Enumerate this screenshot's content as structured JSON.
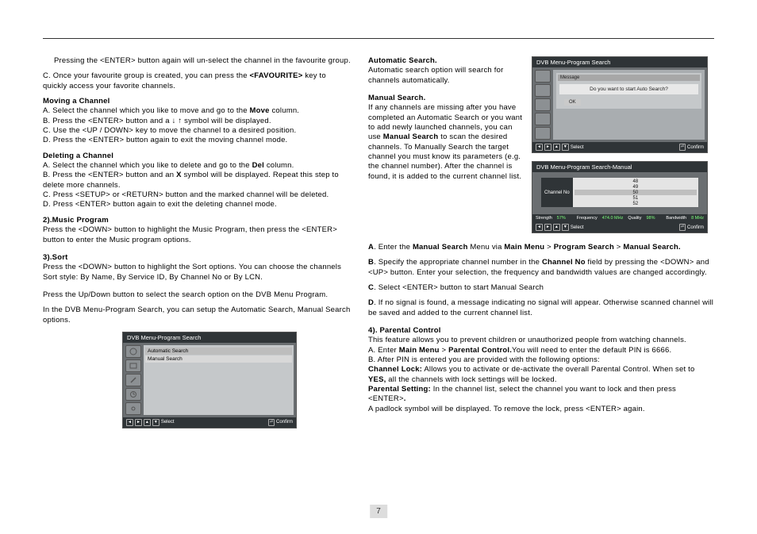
{
  "pageNumber": "7",
  "left": {
    "intro1": "Pressing the <ENTER>  button again will un-select the channel in the favourite group.",
    "intro2": "C.  Once your favourite group is created, you can press the ",
    "intro2b": "<FAVOURITE>",
    "intro2c": " key to quickly access your favorite channels.",
    "moving_title": "Moving a Channel",
    "moving_a_pre": "A. Select the channel which you like to move and go to the ",
    "moving_a_bold": "Move",
    "moving_a_post": " column.",
    "moving_b": "B. Press the <ENTER> button and a  ↓  ↑  symbol will be displayed.",
    "moving_c": "C. Use the <UP / DOWN> key to move the channel to a desired position.",
    "moving_d": "D. Press the <ENTER> button again to exit the moving channel mode.",
    "deleting_title": "Deleting a Channel",
    "deleting_a_pre": "A. Select the channel which you like to delete and go to the ",
    "deleting_a_bold": "Del",
    "deleting_a_post": " column.",
    "deleting_b_pre": "B. Press the <ENTER> button  and an ",
    "deleting_b_bold": "X",
    "deleting_b_post": " symbol will be displayed. Repeat this step to delete more channels.",
    "deleting_c": "C. Press <SETUP> or <RETURN> button and the marked channel will be deleted.",
    "deleting_d": "D. Press <ENTER> button again to exit the deleting channel mode.",
    "music_title": "2).Music Program",
    "music_body": "Press the <DOWN> button to highlight the Music Program, then press the <ENTER> button to enter the Music program options.",
    "sort_title": "3).Sort",
    "sort_body": "Press the <DOWN> button to highlight the Sort options. You can choose the channels Sort style: By Name, By Service ID, By Channel No or By LCN.",
    "search_intro1": "Press the Up/Down button to select the search option on the DVB Menu Program.",
    "search_intro2": "In the DVB Menu-Program Search, you can setup the Automatic Search, Manual Search options."
  },
  "right": {
    "auto_title": "Automatic Search.",
    "auto_body": "Automatic search option will search for channels automatically.",
    "manual_title": "Manual Search.",
    "manual_body_pre": "If any channels are missing after you have completed an Automatic Search or you want to add newly launched channels, you can use ",
    "manual_body_bold": "Manual Search",
    "manual_body_post": " to scan the desired channels. To Manually Search the target channel you must know its parameters (e.g. the channel number).  After the channel is found, it is added to the current channel list.",
    "step_a_pre": "A",
    "step_a_1": ". Enter the ",
    "step_a_bold1": "Manual Search",
    "step_a_2": " Menu via ",
    "step_a_bold2": "Main Menu",
    "step_a_3": " > ",
    "step_a_bold3": "Program Search",
    "step_a_4": " > ",
    "step_a_bold4": "Manual Search.",
    "step_b_pre": "B",
    "step_b_1": ". Specify the appropriate channel number in the ",
    "step_b_bold": "Channel No",
    "step_b_2": " field by pressing the <DOWN> and <UP> button. Enter your selection, the frequency and bandwidth values are changed accordingly.",
    "step_c_pre": "C",
    "step_c_body": ". Select <ENTER> button to start Manual Search",
    "step_d_pre": "D",
    "step_d_body": ". If no signal is found, a message indicating no signal will appear. Otherwise scanned channel will be saved and added to the current channel list.",
    "parental_title": "4). Parental Control",
    "parental_1": "This feature allows you to prevent children or unauthorized people from watching channels.",
    "parental_2_pre": "A. Enter ",
    "parental_2_b1": "Main Menu",
    "parental_2_mid": " > ",
    "parental_2_b2": "Parental Control.",
    "parental_2_post": "You will need to enter the default PIN is 6666.",
    "parental_3": "B. After PIN is entered you are provided with the following options:",
    "parental_4_b": "Channel Lock:",
    "parental_4": " Allows you to activate or de-activate the overall Parental Control. When set to ",
    "parental_4_b2": "YES,",
    "parental_4_post": " all the channels with lock settings will be locked.",
    "parental_5_b": "Parental Setting:",
    "parental_5": " In the channel list, select the channel you want to lock and then press <ENTER>",
    "parental_5_b2": ".",
    "parental_6": "A padlock symbol will be displayed. To remove the lock, press  <ENTER> again."
  },
  "fig1": {
    "title": "DVB Menu-Program Search",
    "opt1": "Automatic Search",
    "opt2": "Manual Search",
    "footer_select": "Select",
    "footer_confirm": "Confirm"
  },
  "fig2": {
    "title": "DVB Menu-Program Search",
    "msg_title": "Message",
    "msg_body": "Do you want to start Auto Search?",
    "ok": "OK",
    "footer_select": "Select",
    "footer_confirm": "Confirm"
  },
  "fig3": {
    "title": "DVB Menu-Program Search-Manual",
    "channel_label": "Channel No",
    "ch1": "48",
    "ch2": "49",
    "ch3": "50",
    "ch4": "51",
    "ch5": "52",
    "s_strength": "Strength",
    "v_strength": "57%",
    "s_quality": "Quality",
    "v_quality": "98%",
    "s_freq": "Frequency",
    "v_freq": "474.0 MHz",
    "s_bw": "Bandwidth",
    "v_bw": "8 MHz",
    "footer_select": "Select",
    "footer_confirm": "Confirm"
  }
}
